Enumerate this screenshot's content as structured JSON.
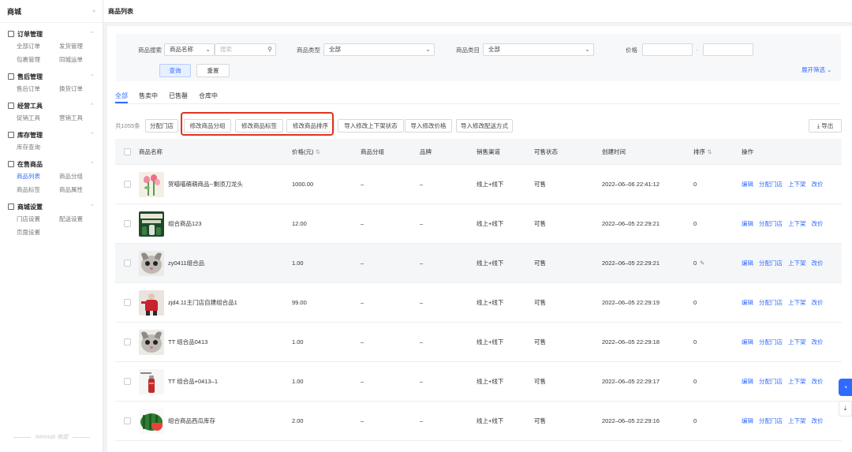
{
  "sidebar": {
    "brand": "商城",
    "collapse_icon": "«",
    "groups": [
      {
        "title": "订单管理",
        "icon": "order-icon",
        "items": [
          "全部订单",
          "发货管理",
          "包裹管理",
          "同城运单"
        ]
      },
      {
        "title": "售后管理",
        "icon": "aftersale-icon",
        "items": [
          "售后订单",
          "换货订单"
        ]
      },
      {
        "title": "经营工具",
        "icon": "tools-icon",
        "items": [
          "促销工具",
          "营销工具"
        ]
      },
      {
        "title": "库存管理",
        "icon": "stock-icon",
        "items": [
          "库存查询"
        ]
      },
      {
        "title": "在售商品",
        "icon": "goods-icon",
        "items": [
          "商品列表",
          "商品分组",
          "商品标签",
          "商品属性"
        ]
      },
      {
        "title": "商城设置",
        "icon": "settings-icon",
        "items": [
          "门店设置",
          "配送设置",
          "页面设置"
        ]
      }
    ],
    "active_item": "商品列表",
    "footer": "Weimob 微盟"
  },
  "page_title": "商品列表",
  "filter": {
    "search_label": "商品搜索",
    "search_field_select": "商品名称",
    "search_placeholder": "搜索",
    "type_label": "商品类型",
    "type_value": "全部",
    "category_label": "商品类目",
    "category_value": "全部",
    "price_label": "价格",
    "price_separator": "-",
    "query_button": "查询",
    "reset_button": "重置",
    "expand_link": "展开筛选"
  },
  "tabs": [
    "全部",
    "售卖中",
    "已售罄",
    "仓库中"
  ],
  "active_tab": "全部",
  "toolbar": {
    "count": "共1055条",
    "buttons": [
      "分配门店",
      "修改商品分组",
      "修改商品标签",
      "修改商品排序",
      "导入修改上下架状态",
      "导入修改价格",
      "导入修改配送方式"
    ],
    "highlighted": [
      "修改商品分组",
      "修改商品标签",
      "修改商品排序"
    ],
    "export_button": "导出"
  },
  "table": {
    "headers": {
      "name": "商品名称",
      "price": "价格(元)",
      "group": "商品分组",
      "brand": "品牌",
      "channel": "销售渠道",
      "status": "可售状态",
      "created": "创建时间",
      "sort": "排序",
      "actions": "操作"
    },
    "rows": [
      {
        "thumb": "tulip-flowers",
        "name": "贺喵喵萌萌商品--剩须刀龙头",
        "price": "1000.00",
        "group": "–",
        "brand": "–",
        "channel": "线上+线下",
        "status": "可售",
        "created": "2022–06–06 22:41:12",
        "sort": "0"
      },
      {
        "thumb": "green-drink-can",
        "name": "组合商品123",
        "price": "12.00",
        "group": "–",
        "brand": "–",
        "channel": "线上+线下",
        "status": "可售",
        "created": "2022–06–05 22:29:21",
        "sort": "0"
      },
      {
        "thumb": "cat-face",
        "name": "zy0411组合品",
        "price": "1.00",
        "group": "–",
        "brand": "–",
        "channel": "线上+线下",
        "status": "可售",
        "created": "2022–06–05 22:29:21",
        "sort": "0"
      },
      {
        "thumb": "red-figure",
        "name": "zjd4.11主门店自建组合品1",
        "price": "99.00",
        "group": "–",
        "brand": "–",
        "channel": "线上+线下",
        "status": "可售",
        "created": "2022–06–05 22:29:19",
        "sort": "0"
      },
      {
        "thumb": "cat-face",
        "name": "TT 组合品0413",
        "price": "1.00",
        "group": "–",
        "brand": "–",
        "channel": "线上+线下",
        "status": "可售",
        "created": "2022–06–05 22:29:18",
        "sort": "0"
      },
      {
        "thumb": "red-bottle",
        "name": "TT 组合品+0413–1",
        "price": "1.00",
        "group": "–",
        "brand": "–",
        "channel": "线上+线下",
        "status": "可售",
        "created": "2022–06–05 22:29:17",
        "sort": "0"
      },
      {
        "thumb": "watermelon",
        "name": "组合商品西瓜库存",
        "price": "2.00",
        "group": "–",
        "brand": "–",
        "channel": "线上+线下",
        "status": "可售",
        "created": "2022–06–05 22:29:16",
        "sort": "0"
      }
    ],
    "row_actions": [
      "编辑",
      "分配门店",
      "上下架",
      "改价"
    ],
    "hover_row": 2
  },
  "floating": {
    "service_icon": "headset-icon",
    "download_icon": "download-icon"
  },
  "colors": {
    "accent": "#2f6bff",
    "highlight_border": "#e0341f"
  }
}
